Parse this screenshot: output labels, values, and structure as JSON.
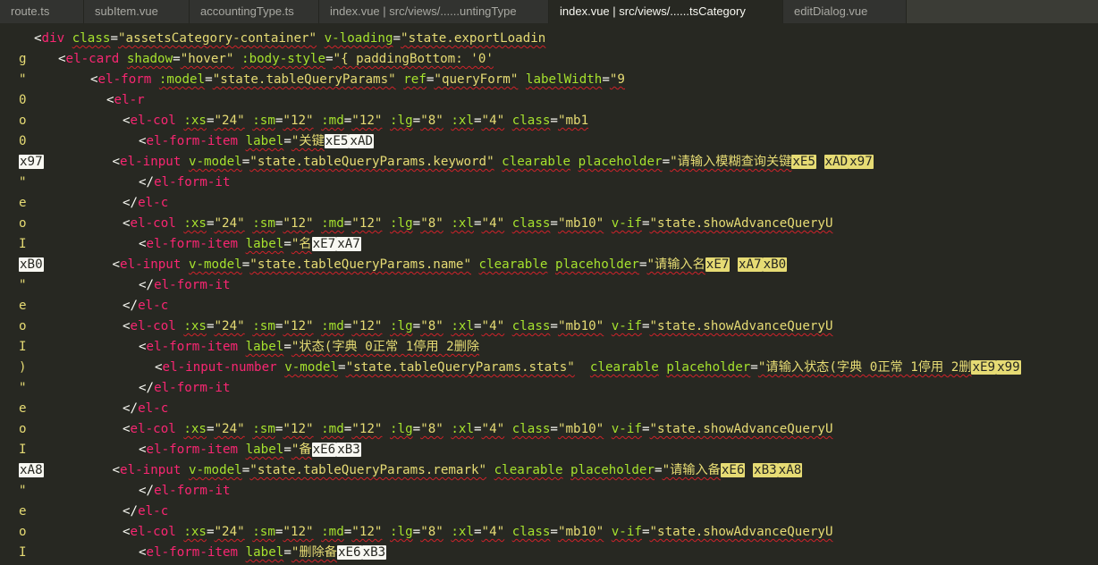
{
  "tabs": [
    {
      "label": "route.ts",
      "w": 94,
      "active": false
    },
    {
      "label": "subItem.vue",
      "w": 118,
      "active": false
    },
    {
      "label": "accountingType.ts",
      "w": 145,
      "active": false
    },
    {
      "label": "index.vue | src/views/......untingType",
      "w": 257,
      "active": false
    },
    {
      "label": "index.vue | src/views/......tsCategory",
      "w": 262,
      "active": true
    },
    {
      "label": "editDialog.vue",
      "w": 138,
      "active": false
    }
  ],
  "lines": [
    {
      "gutter": "",
      "indent": 38,
      "segs": [
        [
          "p",
          "<"
        ],
        [
          "t",
          "div"
        ],
        [
          "p",
          " "
        ],
        [
          "a",
          "class"
        ],
        [
          "p",
          "="
        ],
        [
          "s",
          "\"assetsCategory-container\""
        ],
        [
          "p",
          " "
        ],
        [
          "a",
          "v-loading"
        ],
        [
          "p",
          "="
        ],
        [
          "s",
          "\"state.exportLoadin"
        ]
      ]
    },
    {
      "gutter": "g",
      "indent": 65,
      "segs": [
        [
          "p",
          "<"
        ],
        [
          "t",
          "el-card"
        ],
        [
          "p",
          " "
        ],
        [
          "a",
          "shadow"
        ],
        [
          "p",
          "="
        ],
        [
          "s",
          "\"hover\""
        ],
        [
          "p",
          " "
        ],
        [
          "a",
          ":body-style"
        ],
        [
          "p",
          "="
        ],
        [
          "s",
          "\"{ paddingBottom: '0'"
        ]
      ]
    },
    {
      "gutter": "\"",
      "indent": 101,
      "segs": [
        [
          "p",
          "<"
        ],
        [
          "t",
          "el-form"
        ],
        [
          "p",
          " "
        ],
        [
          "a",
          ":model"
        ],
        [
          "p",
          "="
        ],
        [
          "s",
          "\"state.tableQueryParams\""
        ],
        [
          "p",
          " "
        ],
        [
          "a",
          "ref"
        ],
        [
          "p",
          "="
        ],
        [
          "s",
          "\"queryForm\""
        ],
        [
          "p",
          " "
        ],
        [
          "a",
          "labelWidth"
        ],
        [
          "p",
          "="
        ],
        [
          "s",
          "\"9"
        ]
      ]
    },
    {
      "gutter": "0",
      "indent": 119,
      "segs": [
        [
          "p",
          "<"
        ],
        [
          "t",
          "el-r"
        ]
      ]
    },
    {
      "gutter": "o",
      "indent": 137,
      "segs": [
        [
          "p",
          "<"
        ],
        [
          "t",
          "el-col"
        ],
        [
          "p",
          " "
        ],
        [
          "a",
          ":xs"
        ],
        [
          "p",
          "="
        ],
        [
          "s",
          "\"24\""
        ],
        [
          "p",
          " "
        ],
        [
          "a",
          ":sm"
        ],
        [
          "p",
          "="
        ],
        [
          "s",
          "\"12\""
        ],
        [
          "p",
          " "
        ],
        [
          "a",
          ":md"
        ],
        [
          "p",
          "="
        ],
        [
          "s",
          "\"12\""
        ],
        [
          "p",
          " "
        ],
        [
          "a",
          ":lg"
        ],
        [
          "p",
          "="
        ],
        [
          "s",
          "\"8\""
        ],
        [
          "p",
          " "
        ],
        [
          "a",
          ":xl"
        ],
        [
          "p",
          "="
        ],
        [
          "s",
          "\"4\""
        ],
        [
          "p",
          " "
        ],
        [
          "a",
          "class"
        ],
        [
          "p",
          "="
        ],
        [
          "s",
          "\"mb1"
        ]
      ]
    },
    {
      "gutter": "0",
      "indent": 155,
      "segs": [
        [
          "p",
          "<"
        ],
        [
          "t",
          "el-form-item"
        ],
        [
          "p",
          " "
        ],
        [
          "a",
          "label"
        ],
        [
          "p",
          "="
        ],
        [
          "s",
          "\"关键"
        ],
        [
          "b",
          "xE5"
        ],
        [
          "b",
          "xAD"
        ]
      ]
    },
    {
      "gutter": "",
      "indent": 21,
      "segs": [
        [
          "b",
          "x97"
        ],
        [
          "p",
          "         <"
        ],
        [
          "t",
          "el-input"
        ],
        [
          "p",
          " "
        ],
        [
          "a",
          "v-model"
        ],
        [
          "p",
          "="
        ],
        [
          "s",
          "\"state.tableQueryParams.keyword\""
        ],
        [
          "p",
          " "
        ],
        [
          "a",
          "clearable"
        ],
        [
          "p",
          " "
        ],
        [
          "a",
          "placeholder"
        ],
        [
          "p",
          "="
        ],
        [
          "s",
          "\"请输入模糊查询关键"
        ],
        [
          "y",
          "xE5"
        ],
        [
          "s",
          " "
        ],
        [
          "y",
          "xAD"
        ],
        [
          "y",
          "x97"
        ]
      ]
    },
    {
      "gutter": "\"",
      "indent": 155,
      "segs": [
        [
          "p",
          "</"
        ],
        [
          "t",
          "el-form-it"
        ]
      ]
    },
    {
      "gutter": "e",
      "indent": 137,
      "segs": [
        [
          "p",
          "</"
        ],
        [
          "t",
          "el-c"
        ]
      ]
    },
    {
      "gutter": "o",
      "indent": 137,
      "segs": [
        [
          "p",
          "<"
        ],
        [
          "t",
          "el-col"
        ],
        [
          "p",
          " "
        ],
        [
          "a",
          ":xs"
        ],
        [
          "p",
          "="
        ],
        [
          "s",
          "\"24\""
        ],
        [
          "p",
          " "
        ],
        [
          "a",
          ":sm"
        ],
        [
          "p",
          "="
        ],
        [
          "s",
          "\"12\""
        ],
        [
          "p",
          " "
        ],
        [
          "a",
          ":md"
        ],
        [
          "p",
          "="
        ],
        [
          "s",
          "\"12\""
        ],
        [
          "p",
          " "
        ],
        [
          "a",
          ":lg"
        ],
        [
          "p",
          "="
        ],
        [
          "s",
          "\"8\""
        ],
        [
          "p",
          " "
        ],
        [
          "a",
          ":xl"
        ],
        [
          "p",
          "="
        ],
        [
          "s",
          "\"4\""
        ],
        [
          "p",
          " "
        ],
        [
          "a",
          "class"
        ],
        [
          "p",
          "="
        ],
        [
          "s",
          "\"mb10\""
        ],
        [
          "p",
          " "
        ],
        [
          "a",
          "v-if"
        ],
        [
          "p",
          "="
        ],
        [
          "s",
          "\"state.showAdvanceQueryU"
        ]
      ]
    },
    {
      "gutter": "I",
      "indent": 155,
      "segs": [
        [
          "p",
          "<"
        ],
        [
          "t",
          "el-form-item"
        ],
        [
          "p",
          " "
        ],
        [
          "a",
          "label"
        ],
        [
          "p",
          "="
        ],
        [
          "s",
          "\"名"
        ],
        [
          "b",
          "xE7"
        ],
        [
          "b",
          "xA7"
        ]
      ]
    },
    {
      "gutter": "",
      "indent": 21,
      "segs": [
        [
          "b",
          "xB0"
        ],
        [
          "p",
          "         <"
        ],
        [
          "t",
          "el-input"
        ],
        [
          "p",
          " "
        ],
        [
          "a",
          "v-model"
        ],
        [
          "p",
          "="
        ],
        [
          "s",
          "\"state.tableQueryParams.name\""
        ],
        [
          "p",
          " "
        ],
        [
          "a",
          "clearable"
        ],
        [
          "p",
          " "
        ],
        [
          "a",
          "placeholder"
        ],
        [
          "p",
          "="
        ],
        [
          "s",
          "\"请输入名"
        ],
        [
          "y",
          "xE7"
        ],
        [
          "s",
          " "
        ],
        [
          "y",
          "xA7"
        ],
        [
          "y",
          "xB0"
        ]
      ]
    },
    {
      "gutter": "\"",
      "indent": 155,
      "segs": [
        [
          "p",
          "</"
        ],
        [
          "t",
          "el-form-it"
        ]
      ]
    },
    {
      "gutter": "e",
      "indent": 137,
      "segs": [
        [
          "p",
          "</"
        ],
        [
          "t",
          "el-c"
        ]
      ]
    },
    {
      "gutter": "o",
      "indent": 137,
      "segs": [
        [
          "p",
          "<"
        ],
        [
          "t",
          "el-col"
        ],
        [
          "p",
          " "
        ],
        [
          "a",
          ":xs"
        ],
        [
          "p",
          "="
        ],
        [
          "s",
          "\"24\""
        ],
        [
          "p",
          " "
        ],
        [
          "a",
          ":sm"
        ],
        [
          "p",
          "="
        ],
        [
          "s",
          "\"12\""
        ],
        [
          "p",
          " "
        ],
        [
          "a",
          ":md"
        ],
        [
          "p",
          "="
        ],
        [
          "s",
          "\"12\""
        ],
        [
          "p",
          " "
        ],
        [
          "a",
          ":lg"
        ],
        [
          "p",
          "="
        ],
        [
          "s",
          "\"8\""
        ],
        [
          "p",
          " "
        ],
        [
          "a",
          ":xl"
        ],
        [
          "p",
          "="
        ],
        [
          "s",
          "\"4\""
        ],
        [
          "p",
          " "
        ],
        [
          "a",
          "class"
        ],
        [
          "p",
          "="
        ],
        [
          "s",
          "\"mb10\""
        ],
        [
          "p",
          " "
        ],
        [
          "a",
          "v-if"
        ],
        [
          "p",
          "="
        ],
        [
          "s",
          "\"state.showAdvanceQueryU"
        ]
      ]
    },
    {
      "gutter": "I",
      "indent": 155,
      "segs": [
        [
          "p",
          "<"
        ],
        [
          "t",
          "el-form-item"
        ],
        [
          "p",
          " "
        ],
        [
          "a",
          "label"
        ],
        [
          "p",
          "="
        ],
        [
          "s",
          "\"状态(字典 0正常 1停用 2删除"
        ]
      ]
    },
    {
      "gutter": ")",
      "indent": 173,
      "segs": [
        [
          "p",
          "<"
        ],
        [
          "t",
          "el-input-number"
        ],
        [
          "p",
          " "
        ],
        [
          "a",
          "v-model"
        ],
        [
          "p",
          "="
        ],
        [
          "s",
          "\"state.tableQueryParams.stats\""
        ],
        [
          "p",
          "  "
        ],
        [
          "a",
          "clearable"
        ],
        [
          "p",
          " "
        ],
        [
          "a",
          "placeholder"
        ],
        [
          "p",
          "="
        ],
        [
          "s",
          "\"请输入状态(字典 0正常 1停用 2删"
        ],
        [
          "y",
          "xE9"
        ],
        [
          "y",
          "x99"
        ]
      ]
    },
    {
      "gutter": "\"",
      "indent": 155,
      "segs": [
        [
          "p",
          "</"
        ],
        [
          "t",
          "el-form-it"
        ]
      ]
    },
    {
      "gutter": "e",
      "indent": 137,
      "segs": [
        [
          "p",
          "</"
        ],
        [
          "t",
          "el-c"
        ]
      ]
    },
    {
      "gutter": "o",
      "indent": 137,
      "segs": [
        [
          "p",
          "<"
        ],
        [
          "t",
          "el-col"
        ],
        [
          "p",
          " "
        ],
        [
          "a",
          ":xs"
        ],
        [
          "p",
          "="
        ],
        [
          "s",
          "\"24\""
        ],
        [
          "p",
          " "
        ],
        [
          "a",
          ":sm"
        ],
        [
          "p",
          "="
        ],
        [
          "s",
          "\"12\""
        ],
        [
          "p",
          " "
        ],
        [
          "a",
          ":md"
        ],
        [
          "p",
          "="
        ],
        [
          "s",
          "\"12\""
        ],
        [
          "p",
          " "
        ],
        [
          "a",
          ":lg"
        ],
        [
          "p",
          "="
        ],
        [
          "s",
          "\"8\""
        ],
        [
          "p",
          " "
        ],
        [
          "a",
          ":xl"
        ],
        [
          "p",
          "="
        ],
        [
          "s",
          "\"4\""
        ],
        [
          "p",
          " "
        ],
        [
          "a",
          "class"
        ],
        [
          "p",
          "="
        ],
        [
          "s",
          "\"mb10\""
        ],
        [
          "p",
          " "
        ],
        [
          "a",
          "v-if"
        ],
        [
          "p",
          "="
        ],
        [
          "s",
          "\"state.showAdvanceQueryU"
        ]
      ]
    },
    {
      "gutter": "I",
      "indent": 155,
      "segs": [
        [
          "p",
          "<"
        ],
        [
          "t",
          "el-form-item"
        ],
        [
          "p",
          " "
        ],
        [
          "a",
          "label"
        ],
        [
          "p",
          "="
        ],
        [
          "s",
          "\"备"
        ],
        [
          "b",
          "xE6"
        ],
        [
          "b",
          "xB3"
        ]
      ]
    },
    {
      "gutter": "",
      "indent": 21,
      "segs": [
        [
          "b",
          "xA8"
        ],
        [
          "p",
          "         <"
        ],
        [
          "t",
          "el-input"
        ],
        [
          "p",
          " "
        ],
        [
          "a",
          "v-model"
        ],
        [
          "p",
          "="
        ],
        [
          "s",
          "\"state.tableQueryParams.remark\""
        ],
        [
          "p",
          " "
        ],
        [
          "a",
          "clearable"
        ],
        [
          "p",
          " "
        ],
        [
          "a",
          "placeholder"
        ],
        [
          "p",
          "="
        ],
        [
          "s",
          "\"请输入备"
        ],
        [
          "y",
          "xE6"
        ],
        [
          "s",
          " "
        ],
        [
          "y",
          "xB3"
        ],
        [
          "y",
          "xA8"
        ]
      ]
    },
    {
      "gutter": "\"",
      "indent": 155,
      "segs": [
        [
          "p",
          "</"
        ],
        [
          "t",
          "el-form-it"
        ]
      ]
    },
    {
      "gutter": "e",
      "indent": 137,
      "segs": [
        [
          "p",
          "</"
        ],
        [
          "t",
          "el-c"
        ]
      ]
    },
    {
      "gutter": "o",
      "indent": 137,
      "segs": [
        [
          "p",
          "<"
        ],
        [
          "t",
          "el-col"
        ],
        [
          "p",
          " "
        ],
        [
          "a",
          ":xs"
        ],
        [
          "p",
          "="
        ],
        [
          "s",
          "\"24\""
        ],
        [
          "p",
          " "
        ],
        [
          "a",
          ":sm"
        ],
        [
          "p",
          "="
        ],
        [
          "s",
          "\"12\""
        ],
        [
          "p",
          " "
        ],
        [
          "a",
          ":md"
        ],
        [
          "p",
          "="
        ],
        [
          "s",
          "\"12\""
        ],
        [
          "p",
          " "
        ],
        [
          "a",
          ":lg"
        ],
        [
          "p",
          "="
        ],
        [
          "s",
          "\"8\""
        ],
        [
          "p",
          " "
        ],
        [
          "a",
          ":xl"
        ],
        [
          "p",
          "="
        ],
        [
          "s",
          "\"4\""
        ],
        [
          "p",
          " "
        ],
        [
          "a",
          "class"
        ],
        [
          "p",
          "="
        ],
        [
          "s",
          "\"mb10\""
        ],
        [
          "p",
          " "
        ],
        [
          "a",
          "v-if"
        ],
        [
          "p",
          "="
        ],
        [
          "s",
          "\"state.showAdvanceQueryU"
        ]
      ]
    },
    {
      "gutter": "I",
      "indent": 155,
      "segs": [
        [
          "p",
          "<"
        ],
        [
          "t",
          "el-form-item"
        ],
        [
          "p",
          " "
        ],
        [
          "a",
          "label"
        ],
        [
          "p",
          "="
        ],
        [
          "s",
          "\"删除备"
        ],
        [
          "b",
          "xE6"
        ],
        [
          "b",
          "xB3"
        ]
      ]
    }
  ]
}
